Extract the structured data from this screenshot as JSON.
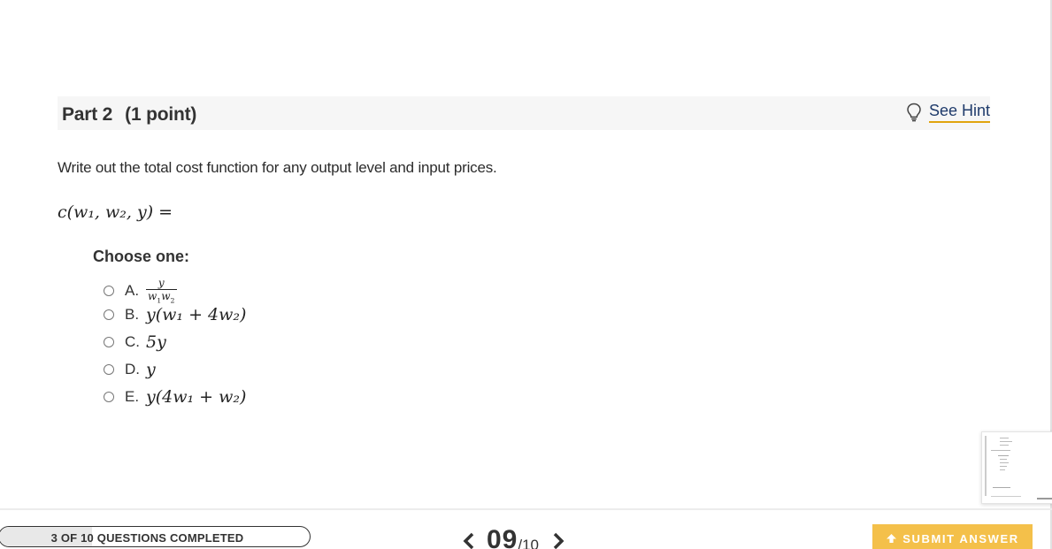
{
  "part": {
    "title": "Part 2",
    "points": "(1 point)",
    "hint_label": "See Hint"
  },
  "question": {
    "prompt": "Write out the total cost function for any output level and input prices.",
    "equation_lhs": "c(w₁, w₂, y)",
    "equation_eq": "="
  },
  "choices": {
    "label": "Choose one:",
    "items": [
      {
        "letter": "A.",
        "expr": "y / (w₁w₂)"
      },
      {
        "letter": "B.",
        "expr": "y(w₁ + 4w₂)"
      },
      {
        "letter": "C.",
        "expr": "5y"
      },
      {
        "letter": "D.",
        "expr": "y"
      },
      {
        "letter": "E.",
        "expr": "y(4w₁ + w₂)"
      }
    ]
  },
  "footer": {
    "progress_label": "3 OF 10 QUESTIONS COMPLETED",
    "progress_fraction": 0.3,
    "current_question": "09",
    "total_questions": "/10",
    "submit_label": "SUBMIT ANSWER"
  },
  "colors": {
    "accent": "#f4c04a",
    "hint_underline": "#e0a40e",
    "link": "#1f3b6b"
  },
  "icons": {
    "hint": "lightbulb-icon",
    "prev": "chevron-left-icon",
    "next": "chevron-right-icon",
    "submit": "upload-arrow-icon"
  }
}
